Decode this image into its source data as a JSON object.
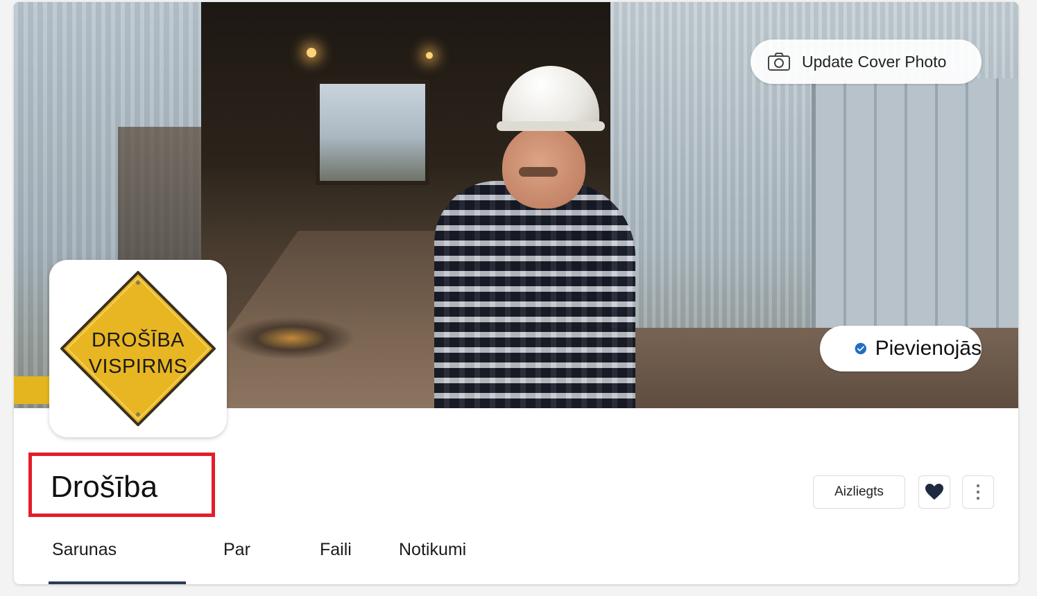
{
  "cover": {
    "update_label": "Update Cover Photo",
    "update_icon": "camera-icon"
  },
  "membership": {
    "status_label": "Pievienojās",
    "status_icon": "check-circle-icon",
    "status_color": "#1f6fc4"
  },
  "group": {
    "avatar_text_line1": "DROŠĪBA",
    "avatar_text_line2": "VISPIRMS",
    "avatar_sign_color": "#e8b623",
    "name": "Drošība",
    "highlight_color": "#e21e2a"
  },
  "actions": {
    "blocked_label": "Aizliegts",
    "like_icon": "heart-icon",
    "more_icon": "more-vertical-icon"
  },
  "tabs": [
    {
      "label": "Sarunas",
      "active": true
    },
    {
      "label": "Par",
      "active": false
    },
    {
      "label": "Faili",
      "active": false
    },
    {
      "label": "Notikumi",
      "active": false
    }
  ],
  "colors": {
    "tab_indicator": "#2b3b57",
    "heart": "#1d2a3f"
  }
}
